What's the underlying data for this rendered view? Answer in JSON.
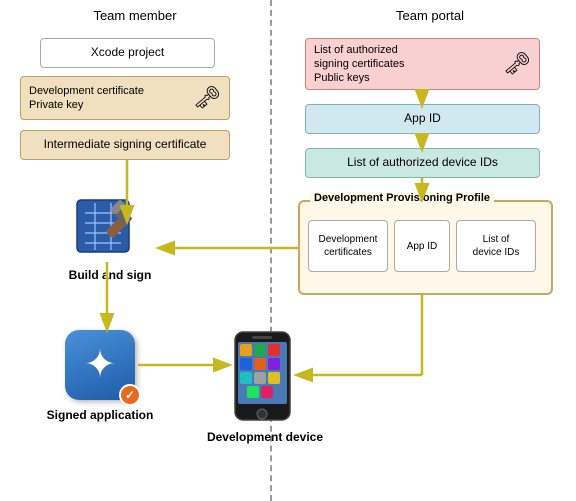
{
  "headers": {
    "left": "Team member",
    "right": "Team portal"
  },
  "boxes": {
    "xcode_project": "Xcode project",
    "dev_cert": "Development certificate\nPrivate key",
    "intermediate": "Intermediate signing certificate",
    "signing_certs": "List of authorized\nsigning certificates\nPublic keys",
    "app_id_top": "App ID",
    "device_ids": "List of authorized device IDs",
    "profile_title": "Development Provisioning Profile",
    "profile_dev_certs": "Development\ncertificates",
    "profile_app_id": "App ID",
    "profile_device_ids": "List of\ndevice IDs"
  },
  "labels": {
    "build_sign": "Build and sign",
    "signed_app": "Signed application",
    "dev_device": "Development device"
  },
  "colors": {
    "arrow": "#d4c830",
    "box_pink_bg": "#f9d0d0",
    "box_blue_bg": "#d0e8f0",
    "box_teal_bg": "#c8e8e0",
    "box_orange_bg": "#f0e0c0"
  }
}
